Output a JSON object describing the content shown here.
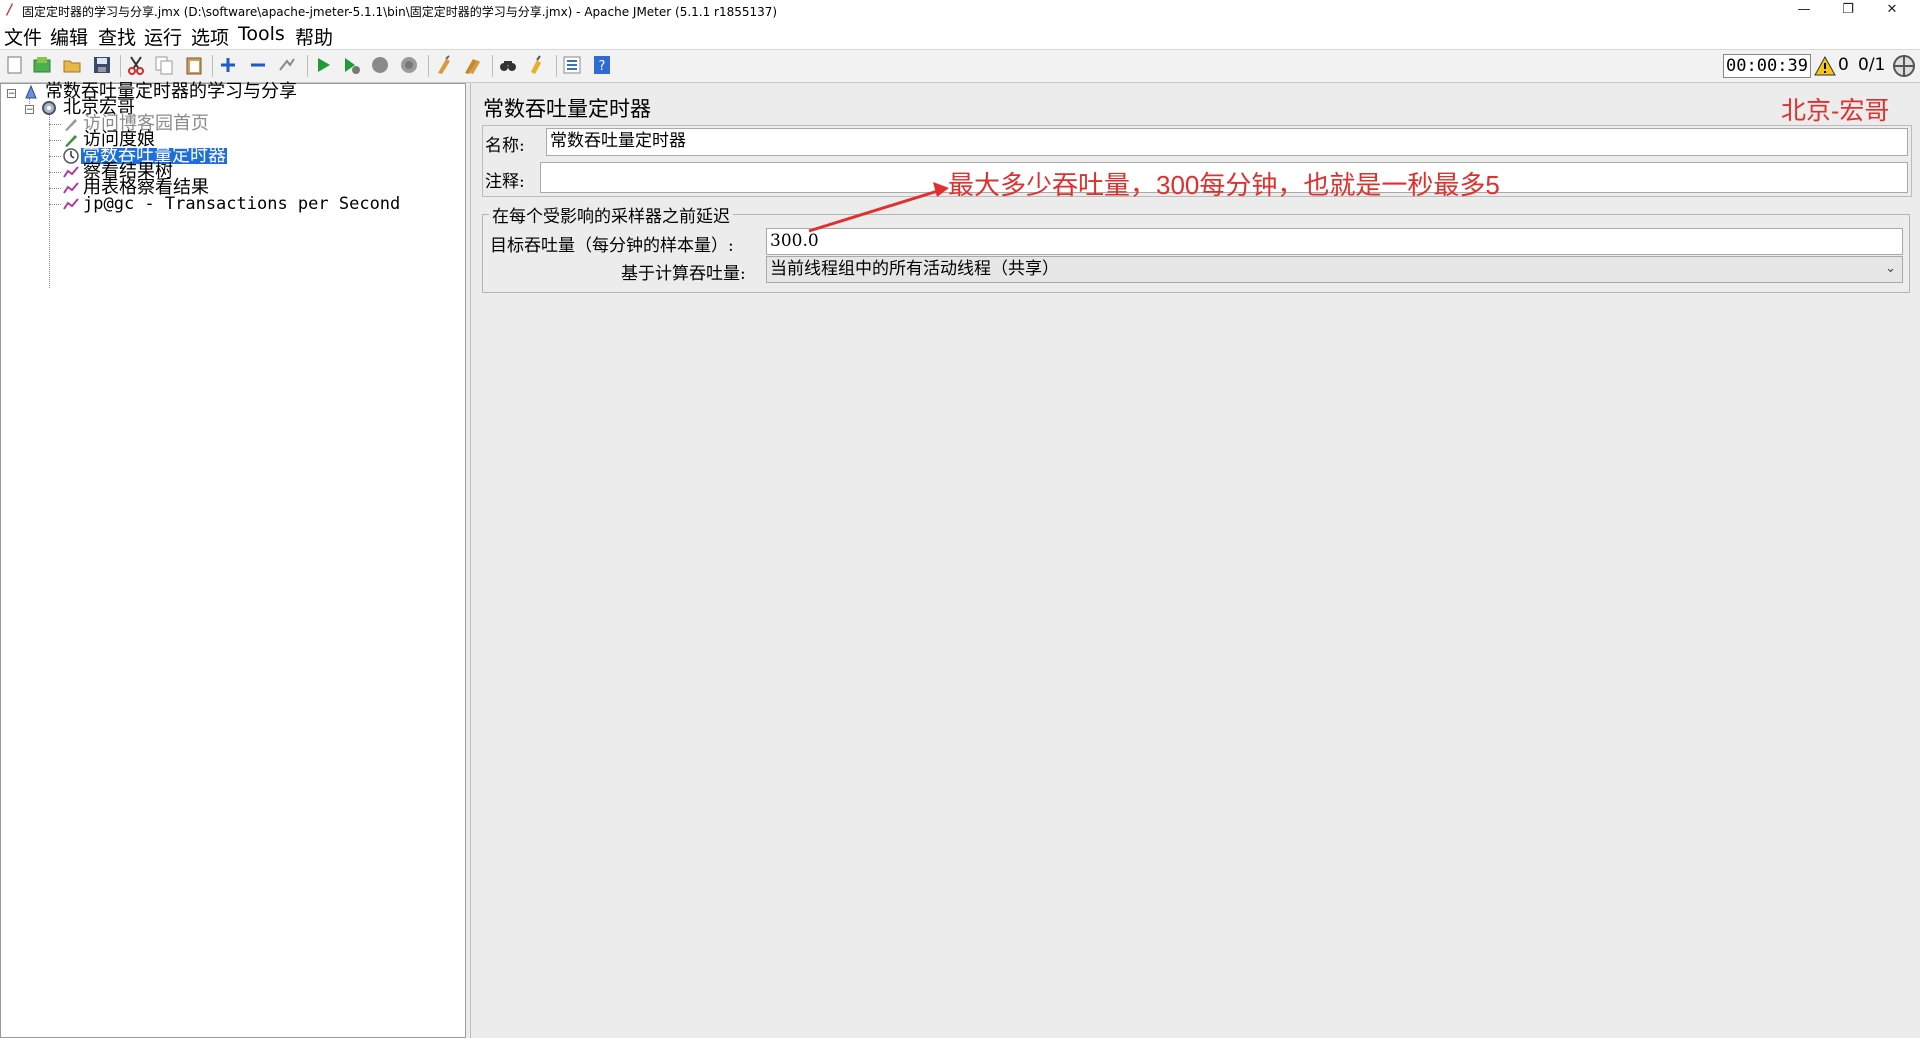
{
  "window": {
    "title": "固定定时器的学习与分享.jmx (D:\\software\\apache-jmeter-5.1.1\\bin\\固定定时器的学习与分享.jmx) - Apache JMeter (5.1.1 r1855137)",
    "minimize": "—",
    "maximize": "❐",
    "close": "✕"
  },
  "menu": [
    "文件",
    "编辑",
    "查找",
    "运行",
    "选项",
    "Tools",
    "帮助"
  ],
  "toolbar": {
    "icons": [
      "new-icon",
      "templates-icon",
      "open-icon",
      "save-icon",
      "cut-icon",
      "copy-icon",
      "paste-icon",
      "expand-icon",
      "collapse-icon",
      "toggle-icon",
      "start-icon",
      "start-no-pause-icon",
      "stop-icon",
      "shutdown-icon",
      "clear-icon",
      "clear-all-icon",
      "search-icon",
      "reset-search-icon",
      "function-helper-icon",
      "help-icon"
    ],
    "timer": "00:00:39",
    "error_count": "0",
    "threads": "0/1"
  },
  "tree": {
    "root": "常数吞吐量定时器的学习与分享",
    "thread_group": "北京宏哥",
    "items": [
      {
        "label": "访问博客园首页",
        "icon": "sampler-icon",
        "disabled": true
      },
      {
        "label": "访问度娘",
        "icon": "sampler-icon",
        "disabled": false
      },
      {
        "label": "常数吞吐量定时器",
        "icon": "timer-icon",
        "selected": true
      },
      {
        "label": "察看结果树",
        "icon": "listener-icon",
        "disabled": false
      },
      {
        "label": "用表格察看结果",
        "icon": "listener-icon",
        "disabled": false
      },
      {
        "label": "jp@gc - Transactions per Second",
        "icon": "listener-icon",
        "disabled": false
      }
    ]
  },
  "panel": {
    "title": "常数吞吐量定时器",
    "watermark": "北京-宏哥",
    "name_label": "名称:",
    "name_value": "常数吞吐量定时器",
    "comment_label": "注释:",
    "comment_value": "",
    "group_title": "在每个受影响的采样器之前延迟",
    "target_label": "目标吞吐量（每分钟的样本量）:",
    "target_value": "300.0",
    "based_on_label": "基于计算吞吐量:",
    "based_on_value": "当前线程组中的所有活动线程（共享）"
  },
  "annotation": {
    "text": "最大多少吞吐量，300每分钟，也就是一秒最多5",
    "color": "#e0302e"
  }
}
